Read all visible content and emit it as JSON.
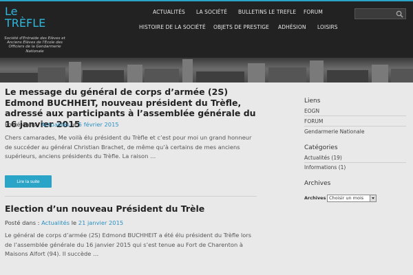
{
  "site": {
    "logo_line1": "Le",
    "logo_line2": "TRÈFLE",
    "tagline": "Société d'Entraide des Elèves et Anciens Elèves de l'Ecole des Officiers de la Gendarmerie Nationale"
  },
  "nav": {
    "items": [
      "ACTUALITÉS",
      "LA SOCIÉTÉ",
      "BULLETINS LE TREFLE",
      "FORUM",
      "HISTOIRE DE LA SOCIÉTÉ",
      "OBJETS DE PRESTIGE",
      "ADHÉSION",
      "LOISIRS"
    ]
  },
  "search": {
    "placeholder": "",
    "icon": "search-icon"
  },
  "posts": [
    {
      "title": "Le message du général de corps d’armée (2S) Edmond BUCHHEIT, nouveau président du Trèfle, adressé aux participants à l’assemblée générale du 16 janvier 2015",
      "posted_in": "Posté dans :",
      "category": "Actualités",
      "date_prefix": "le",
      "date": "5 février 2015",
      "excerpt": "Chers camarades, Me voilà élu président du Trèfle et c’est pour moi un grand honneur de succéder au général Christian Brachet, de même qu’à certains de mes anciens supérieurs, anciens présidents du Trèfle. La raison …",
      "read_more": "Lire la suite"
    },
    {
      "title": "Election d’un nouveau Président du Trèle",
      "posted_in": "Posté dans :",
      "category": "Actualités",
      "date_prefix": "le",
      "date": "21 janvier 2015",
      "excerpt": "Le général de corps d’armée (2S) Edmond BUCHHEIT a été élu président du Trèfle lors de l’assemblée générale du 16 janvier 2015 qui s’est tenue au Fort de Charenton à Maisons Alfort (94). Il succède …"
    }
  ],
  "sidebar": {
    "links_title": "Liens",
    "links": [
      "EOGN",
      "FORUM",
      "Gendarmerie Nationale"
    ],
    "categories_title": "Catégories",
    "categories": [
      "Actualités (19)",
      "Informations (1)"
    ],
    "archives_title": "Archives",
    "archives_label": "Archives",
    "archives_select": "Choisir un mois"
  },
  "colors": {
    "accent": "#2aa4c7",
    "header_bg": "#222222",
    "link": "#2a8fc2"
  }
}
